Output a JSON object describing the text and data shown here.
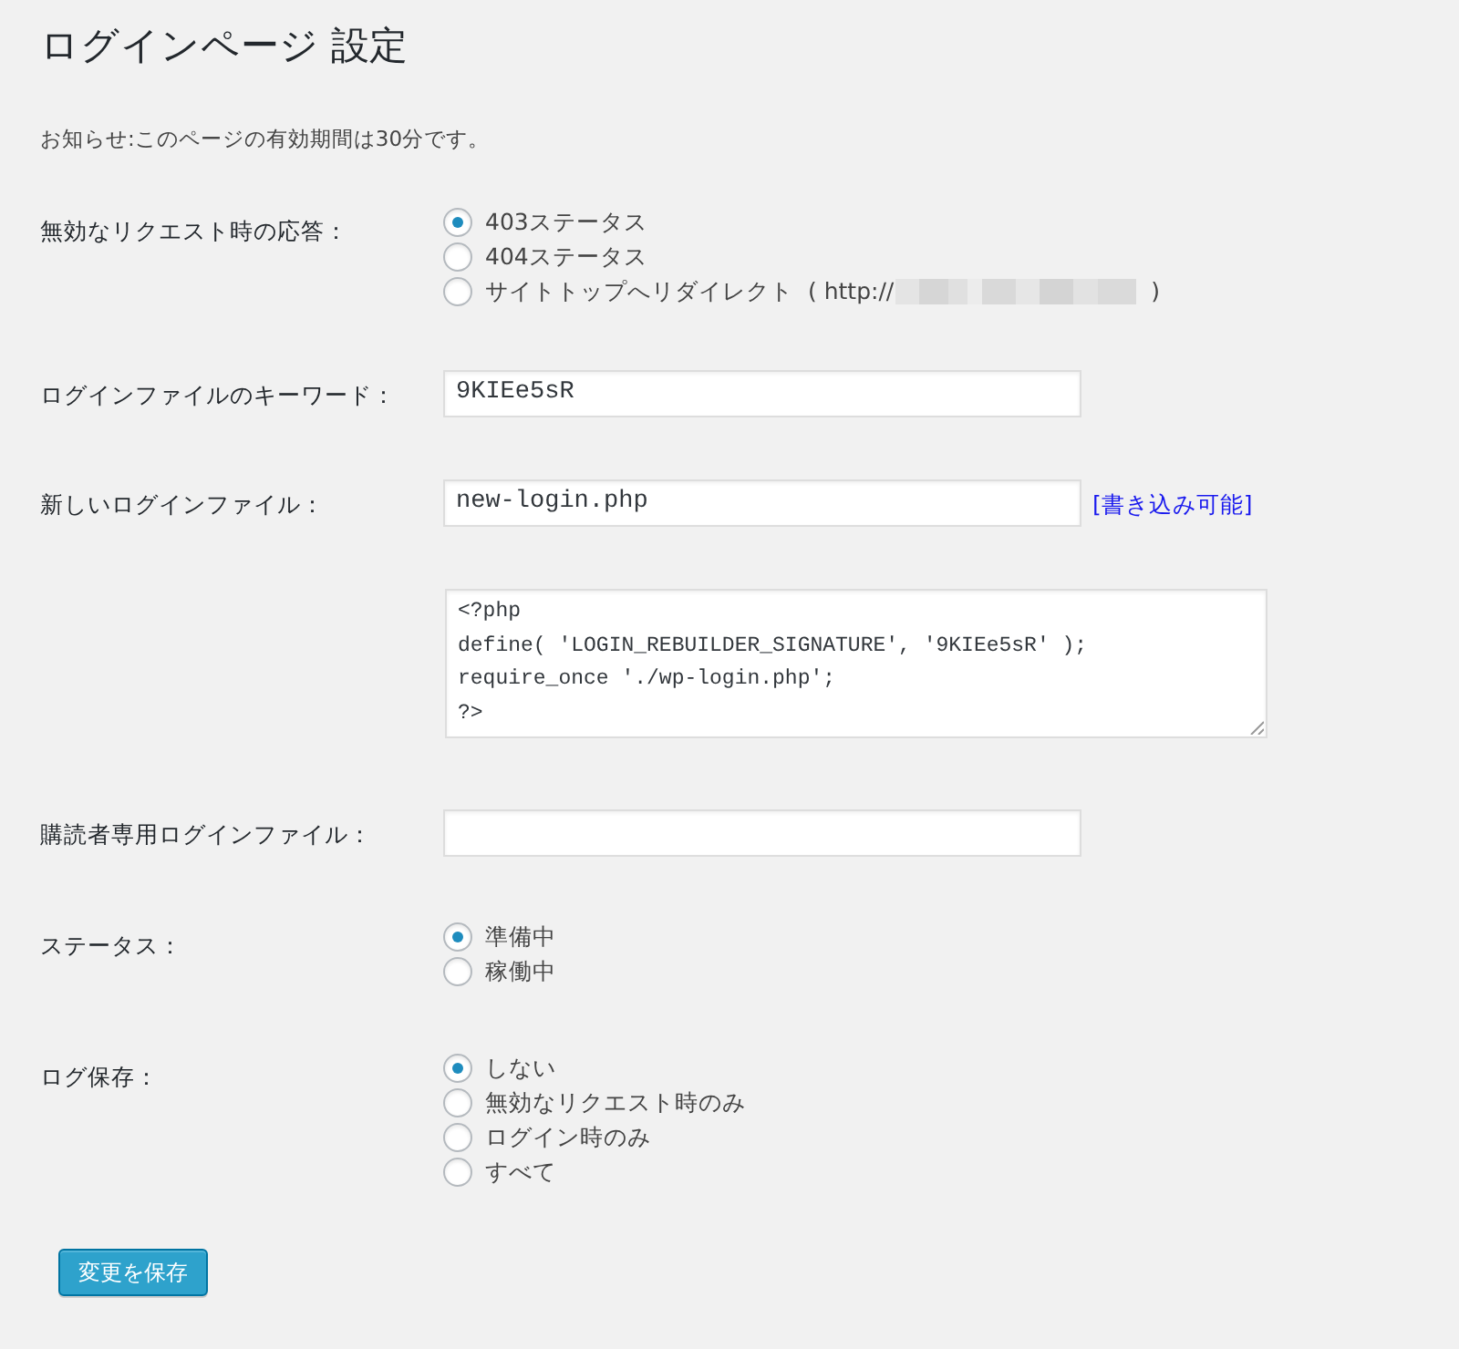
{
  "page": {
    "title": "ログインページ 設定",
    "notice": "お知らせ:このページの有効期間は30分です。"
  },
  "settings": [
    {
      "kind": "radio",
      "label": "無効なリクエスト時の応答：",
      "options": [
        {
          "kind": "text",
          "label": "403ステータス",
          "selected": true
        },
        {
          "kind": "text",
          "label": "404ステータス",
          "selected": false
        },
        {
          "kind": "redirect",
          "label": "サイトトップへリダイレクト",
          "url_prefix": "( http://",
          "suffix": ")",
          "selected": false
        }
      ]
    },
    {
      "kind": "input",
      "label": "ログインファイルのキーワード：",
      "value": "9KIEe5sR"
    },
    {
      "kind": "input",
      "label": "新しいログインファイル：",
      "value": "new-login.php",
      "link": "[書き込み可能]"
    },
    {
      "kind": "code",
      "value": "<?php\ndefine( 'LOGIN_REBUILDER_SIGNATURE', '9KIEe5sR' );\nrequire_once './wp-login.php';\n?>"
    },
    {
      "kind": "input",
      "label": "購読者専用ログインファイル："
    },
    {
      "kind": "radio",
      "label": "ステータス：",
      "options": [
        {
          "kind": "text",
          "label": "準備中",
          "selected": true
        },
        {
          "kind": "text",
          "label": "稼働中",
          "selected": false
        }
      ]
    },
    {
      "kind": "radio",
      "label": "ログ保存：",
      "options": [
        {
          "kind": "text",
          "label": "しない",
          "selected": true
        },
        {
          "kind": "text",
          "label": "無効なリクエスト時のみ",
          "selected": false
        },
        {
          "kind": "text",
          "label": "ログイン時のみ",
          "selected": false
        },
        {
          "kind": "text",
          "label": "すべて",
          "selected": false
        }
      ]
    }
  ],
  "save_button": "変更を保存"
}
